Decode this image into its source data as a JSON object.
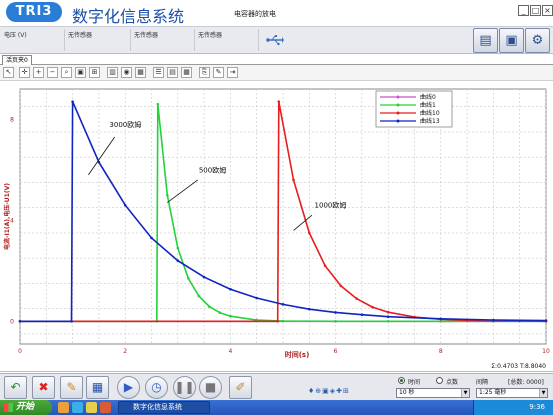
{
  "app": {
    "logo_text": "TRI3",
    "title": "数字化信息系统",
    "document_title": "电容器的放电",
    "window_buttons": {
      "minimize": "_",
      "restore": "□",
      "close": "×"
    }
  },
  "sensors": [
    {
      "label": "电压 (V)"
    },
    {
      "label": "无传感器"
    },
    {
      "label": "无传感器"
    },
    {
      "label": "无传感器"
    }
  ],
  "side_buttons": [
    "save-icon",
    "export-icon",
    "settings-icon"
  ],
  "tabs": [
    {
      "label": "活页夹0"
    }
  ],
  "toolbar_icons": [
    "select-icon",
    "crosshair-icon",
    "zoom-in-icon",
    "zoom-out-icon",
    "magnify-icon",
    "fit-icon",
    "grid-icon",
    "bars-icon",
    "record-icon",
    "table-icon",
    "list-icon",
    "chart-icon",
    "sheet-icon",
    "copy-icon",
    "edit-icon",
    "export-icon"
  ],
  "chart": {
    "type": "line",
    "ylabel": "电流-I1(A),电压-U1(V)",
    "xlabel": "时间(s)",
    "readout": "Σ:0.4703 T:8.8040",
    "legend": [
      {
        "name": "曲线0",
        "color": "#c855c8"
      },
      {
        "name": "曲线1",
        "color": "#22d33a"
      },
      {
        "name": "曲线10",
        "color": "#e81e1e"
      },
      {
        "name": "曲线13",
        "color": "#1025c0"
      }
    ],
    "annotations": [
      {
        "text": "3000欧姆"
      },
      {
        "text": "500欧姆"
      },
      {
        "text": "1000欧姆"
      }
    ]
  },
  "chart_data": {
    "type": "line",
    "xlabel": "时间(s)",
    "ylabel": "电流-I1(A),电压-U1(V)",
    "xlim": [
      0,
      10
    ],
    "ylim": [
      -0.9,
      9.2
    ],
    "x_ticks": [
      0,
      2,
      4,
      6,
      8,
      10
    ],
    "y_ticks": [
      0,
      4,
      8
    ],
    "grid": true,
    "legend_position": "top-right",
    "series": [
      {
        "name": "曲线0",
        "color": "#c855c8",
        "x": [
          0,
          10
        ],
        "y": [
          0,
          0
        ]
      },
      {
        "name": "曲线1",
        "color": "#22d33a",
        "x": [
          0,
          2.6,
          2.62,
          2.8,
          3.0,
          3.2,
          3.4,
          3.6,
          3.8,
          4.0,
          4.5,
          5.0,
          6.0,
          7.0,
          8.0,
          9.0,
          10.0
        ],
        "y": [
          0,
          0,
          8.6,
          5.0,
          2.9,
          1.7,
          1.0,
          0.58,
          0.34,
          0.2,
          0.05,
          0.01,
          0,
          0,
          0,
          0,
          0
        ]
      },
      {
        "name": "曲线10",
        "color": "#e81e1e",
        "x": [
          0,
          4.9,
          4.92,
          5.2,
          5.5,
          5.8,
          6.1,
          6.4,
          6.7,
          7.0,
          7.5,
          8.0,
          8.5,
          9.0,
          9.5,
          10.0
        ],
        "y": [
          0,
          0,
          8.7,
          5.6,
          3.5,
          2.2,
          1.4,
          0.9,
          0.56,
          0.36,
          0.17,
          0.08,
          0.04,
          0.02,
          0.01,
          0
        ]
      },
      {
        "name": "曲线13",
        "color": "#1025c0",
        "x": [
          0,
          0.98,
          1.0,
          1.5,
          2.0,
          2.5,
          3.0,
          3.5,
          4.0,
          4.5,
          5.0,
          5.5,
          6.0,
          6.5,
          7.0,
          8.0,
          9.0,
          10.0
        ],
        "y": [
          0,
          0,
          8.7,
          6.3,
          4.6,
          3.3,
          2.4,
          1.75,
          1.27,
          0.92,
          0.67,
          0.48,
          0.35,
          0.26,
          0.18,
          0.1,
          0.05,
          0.03
        ]
      }
    ]
  },
  "controls": {
    "x_mode": {
      "time_label": "时间",
      "points_label": "点数"
    },
    "time_select": "10 秒",
    "interval_label": "间隔",
    "total_label": "[总数: 0000]",
    "interval_select": "1:25 毫秒",
    "tiny_tools": "♦⊕▣◈✚⊞"
  },
  "taskbar": {
    "start": "开始",
    "task_title": "数字化信息系统",
    "clock": "9:36"
  }
}
